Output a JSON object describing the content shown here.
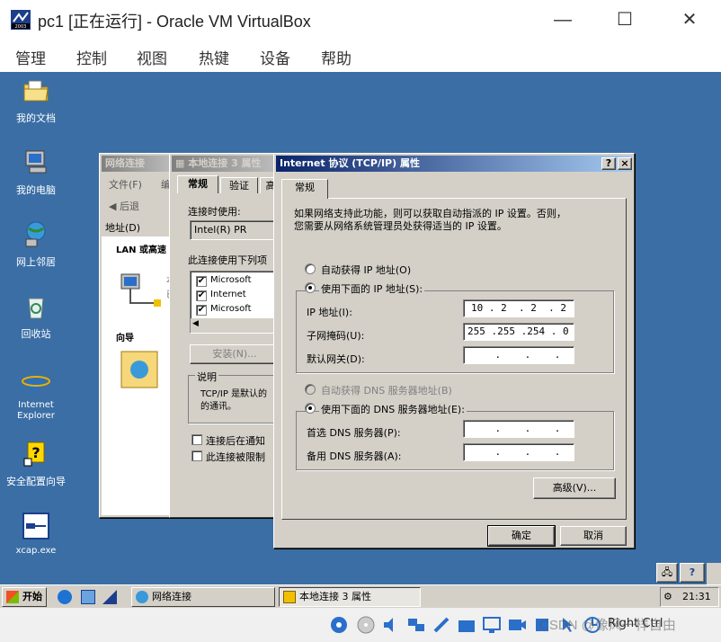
{
  "host": {
    "title": "pc1 [正在运行] - Oracle VM VirtualBox",
    "menu": [
      "管理",
      "控制",
      "视图",
      "热键",
      "设备",
      "帮助"
    ],
    "minimize": "—",
    "maximize": "☐",
    "close": "✕"
  },
  "desktop_icons": [
    {
      "name": "my-documents",
      "label": "我的文档"
    },
    {
      "name": "my-computer",
      "label": "我的电脑"
    },
    {
      "name": "network-places",
      "label": "网上邻居"
    },
    {
      "name": "recycle-bin",
      "label": "回收站"
    },
    {
      "name": "internet-explorer",
      "label": "Internet\nExplorer"
    },
    {
      "name": "security-wizard",
      "label": "安全配置向导"
    },
    {
      "name": "xcap",
      "label": "xcap.exe"
    }
  ],
  "netconn_window": {
    "title": "网络连接",
    "menu_file": "文件(F)",
    "menu_edit": "编",
    "back": "后退",
    "address_label": "地址(D)",
    "lan_header": "LAN 或高速",
    "guide_header": "向导",
    "item_short": "本",
    "item_short2": "已"
  },
  "local_props": {
    "title": "本地连接 3 属性",
    "tabs": [
      "常规",
      "验证",
      "高"
    ],
    "connect_using": "连接时使用:",
    "adapter": "Intel(R) PR",
    "items_label": "此连接使用下列项",
    "items": [
      "Microsoft",
      "Internet",
      "Microsoft"
    ],
    "install_btn": "安装(N)...",
    "desc_title": "说明",
    "desc_text1": "TCP/IP 是默认的",
    "desc_text2": "的通讯。",
    "chk_notify": "连接后在通知",
    "chk_limited": "此连接被限制"
  },
  "tcpip": {
    "title": "Internet 协议 (TCP/IP) 属性",
    "help": "?",
    "close": "×",
    "tab": "常规",
    "intro1": "如果网络支持此功能，则可以获取自动指派的 IP 设置。否则，",
    "intro2": "您需要从网络系统管理员处获得适当的 IP 设置。",
    "auto_ip": "自动获得 IP 地址(O)",
    "manual_ip": "使用下面的 IP 地址(S):",
    "ip_label": "IP 地址(I):",
    "ip_value": "10 . 2  . 2  . 2",
    "mask_label": "子网掩码(U):",
    "mask_value": "255 .255 .254 . 0",
    "gw_label": "默认网关(D):",
    "gw_value": "    .    .    .",
    "auto_dns": "自动获得 DNS 服务器地址(B)",
    "manual_dns": "使用下面的 DNS 服务器地址(E):",
    "dns1_label": "首选 DNS 服务器(P):",
    "dns1_value": "    .    .    .",
    "dns2_label": "备用 DNS 服务器(A):",
    "dns2_value": "    .    .    .",
    "advanced_btn": "高级(V)...",
    "ok_btn": "确定",
    "cancel_btn": "取消"
  },
  "taskbar": {
    "start": "开始",
    "task1": "网络连接",
    "task2": "本地连接 3 属性",
    "clock": "21:31"
  },
  "status": {
    "host_key": "Right Ctrl",
    "watermark": "CSDN @像风一样自由"
  },
  "colors": {
    "desktop": "#3a6ea5",
    "active_title": "#0a246a",
    "window_face": "#d4d0c8"
  }
}
